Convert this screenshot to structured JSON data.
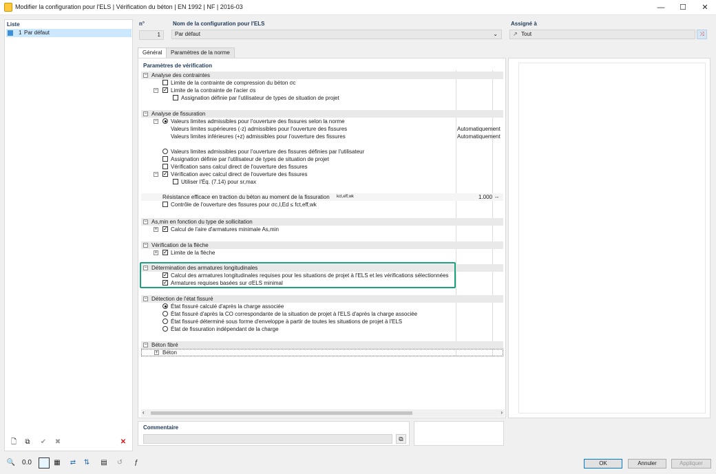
{
  "window": {
    "title": "Modifier la configuration pour l'ELS | Vérification du béton | EN 1992 | NF | 2016-03",
    "min": "—",
    "max": "☐",
    "close": "✕"
  },
  "list": {
    "header": "Liste",
    "items": [
      {
        "num": "1",
        "label": "Par défaut"
      }
    ]
  },
  "config": {
    "num_label": "n°",
    "num_value": "1",
    "name_label": "Nom de la configuration pour l'ELS",
    "name_value": "Par défaut",
    "assigned_label": "Assigné à",
    "assigned_value": "Tout"
  },
  "tabs": [
    "Général",
    "Paramètres de la norme"
  ],
  "params_title": "Paramètres de vérification",
  "sections": {
    "contraintes": "Analyse des contraintes",
    "fissuration": "Analyse de fissuration",
    "as_min": "As,min en fonction du type de sollicitation",
    "fleche": "Vérification de la flèche",
    "armatures": "Détermination des armatures longitudinales",
    "etat": "Détection de l'état fissuré",
    "fibre": "Béton fibré"
  },
  "rows": {
    "c1": "Limite de la contrainte de compression du béton σc",
    "c2": "Limite de la contrainte de l'acier σs",
    "c3": "Assignation définie par l'utilisateur de types de situation de projet",
    "f1": "Valeurs limites admissibles pour l'ouverture des fissures selon la norme",
    "f2": "Valeurs limites supérieures (-z) admissibles pour l'ouverture des fissures",
    "f2v": "Automatiquement",
    "f3": "Valeurs limites inférieures (+z) admissibles pour l'ouverture des fissures",
    "f3v": "Automatiquement",
    "f4": "Valeurs limites admissibles pour l'ouverture des fissures définies par l'utilisateur",
    "f5": "Assignation définie par l'utilisateur de types de situation de projet",
    "f6": "Vérification sans calcul direct de l'ouverture des fissures",
    "f7": "Vérification avec calcul direct de l'ouverture des fissures",
    "f8": "Utiliser l'Éq. (7.14) pour sr,max",
    "f9": "Résistance efficace en traction du béton au moment de la fissuration",
    "f9s": "kct,eff,wk",
    "f9v": "1.000",
    "f9u": "--",
    "f10": "Contrôle de l'ouverture des fissures pour σc,I,Ed ≤ fct,eff,wk",
    "a1": "Calcul de l'aire d'armatures minimale As,min",
    "l1": "Limite de la flèche",
    "r1": "Calcul des armatures longitudinales requises pour les situations de projet à l'ELS et les vérifications sélectionnées",
    "r2": "Armatures requises basées sur σELS minimal",
    "e1": "État fissuré calculé d'après la charge associée",
    "e2": "État fissuré d'après la CO correspondante de la situation de projet à l'ELS d'après la charge associée",
    "e3": "État fissuré déterminé sous forme d'enveloppe à partir de toutes les situations de projet à l'ELS",
    "e4": "État de fissuration indépendant de la charge",
    "b1": "Béton"
  },
  "comment_label": "Commentaire",
  "buttons": {
    "ok": "OK",
    "cancel": "Annuler",
    "apply": "Appliquer"
  },
  "colors": {
    "highlight": "#1aa27f",
    "accent": "#2b6cb0"
  }
}
